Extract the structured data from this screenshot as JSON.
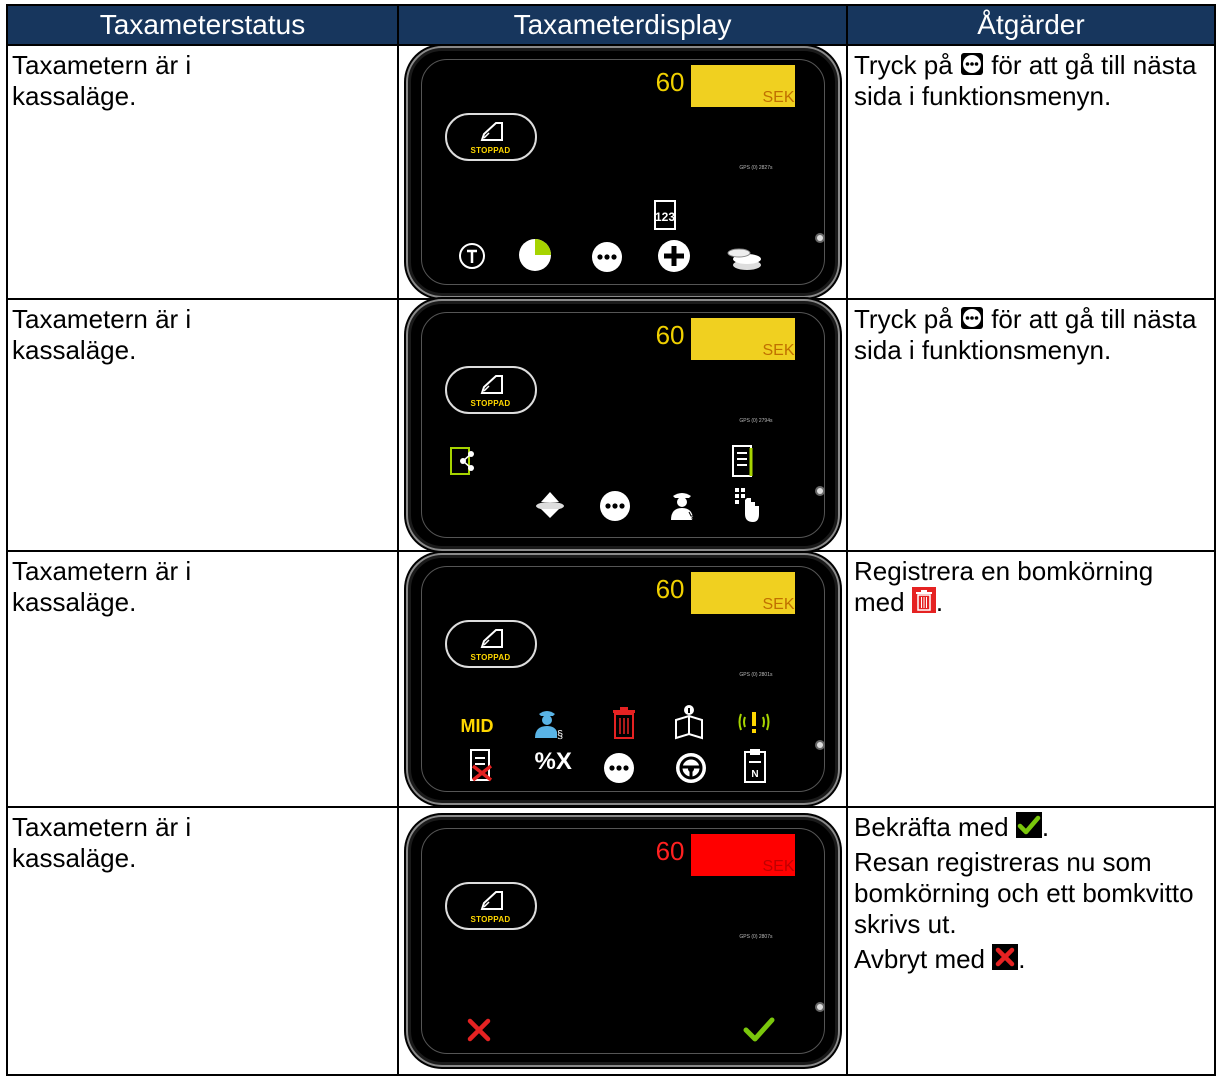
{
  "table": {
    "headers": [
      "Taxameterstatus",
      "Taxameterdisplay",
      "Åtgärder"
    ],
    "rows": [
      {
        "status": "Taxametern är i kassaläge.",
        "display": {
          "amount": "60",
          "currency": "SEK",
          "stop_label": "STOPPAD",
          "gps": "GPS (0) 2827s"
        },
        "action": {
          "before": "Tryck på",
          "icon": "more-icon",
          "after": "för att gå till nästa sida i funktionsmenyn."
        }
      },
      {
        "status": "Taxametern är i kassaläge.",
        "display": {
          "amount": "60",
          "currency": "SEK",
          "stop_label": "STOPPAD",
          "gps": "GPS (0) 2794s"
        },
        "action": {
          "before": "Tryck på",
          "icon": "more-icon",
          "after": "för att gå till nästa sida i funktionsmenyn."
        }
      },
      {
        "status": "Taxametern är i kassaläge.",
        "display": {
          "amount": "60",
          "currency": "SEK",
          "stop_label": "STOPPAD",
          "gps": "GPS (0) 2801s",
          "mid_label": "MID",
          "percent_label": "%X"
        },
        "action": {
          "before": "Registrera en bomkörning med",
          "icon": "trash-icon",
          "after": "."
        }
      },
      {
        "status": "Taxametern är i kassaläge.",
        "display": {
          "amount": "60",
          "currency": "SEK",
          "stop_label": "STOPPAD",
          "gps": "GPS (0) 2807s"
        },
        "action": {
          "confirm_before": "Bekräfta med",
          "confirm_after": ".",
          "info": "Resan registreras nu som bomkörning och ett bomkvitto skrivs ut.",
          "cancel_before": "Avbryt med",
          "cancel_after": "."
        }
      }
    ]
  },
  "colors": {
    "header_bg": "#17365d",
    "amount_yellow": "#f0d020",
    "amount_red": "#ff0000",
    "confirm_green": "#7ac70c",
    "cancel_red": "#e52222",
    "trash_red": "#e52222",
    "accent_green": "#a6d400"
  }
}
